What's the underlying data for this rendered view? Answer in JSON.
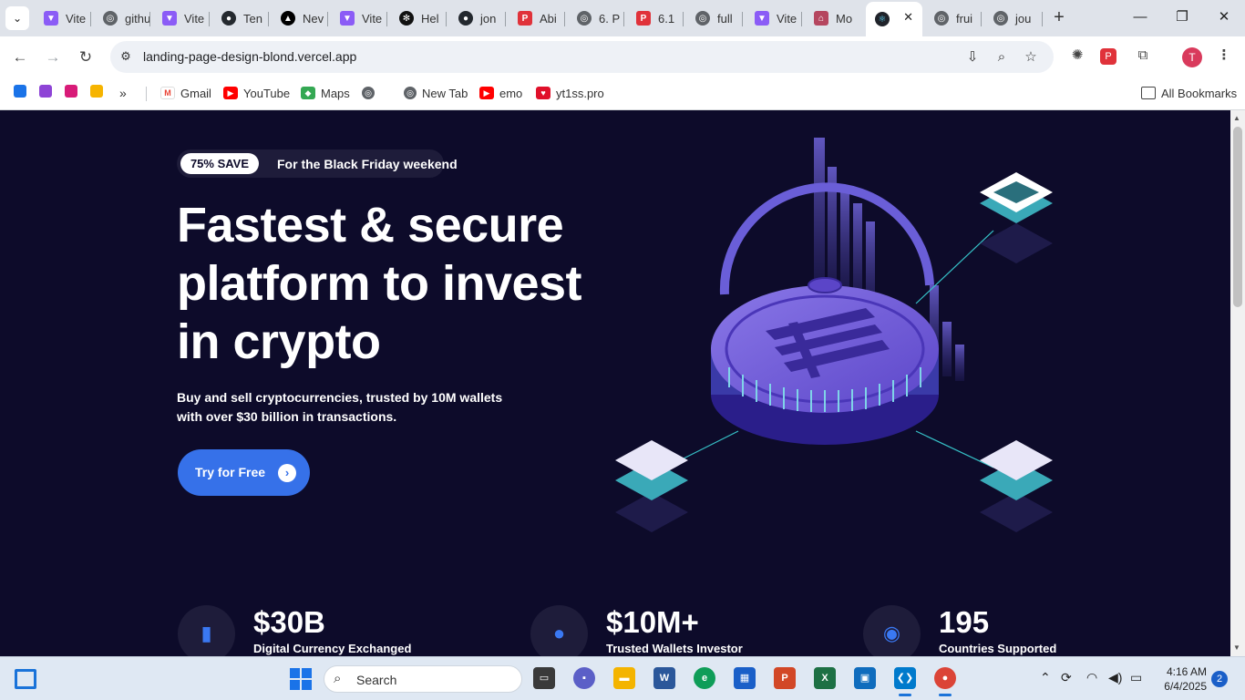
{
  "browser": {
    "tabs": [
      {
        "title": "Vite",
        "icon": "vite-icon"
      },
      {
        "title": "github",
        "icon": "globe-icon"
      },
      {
        "title": "Vite",
        "icon": "vite-icon"
      },
      {
        "title": "Ten",
        "icon": "github-icon"
      },
      {
        "title": "Nev",
        "icon": "vercel-icon"
      },
      {
        "title": "Vite",
        "icon": "vite-icon"
      },
      {
        "title": "Hel",
        "icon": "openai-icon"
      },
      {
        "title": "jon",
        "icon": "github-icon"
      },
      {
        "title": "Abi",
        "icon": "pdf-icon"
      },
      {
        "title": "6. P",
        "icon": "globe-icon"
      },
      {
        "title": "6.1",
        "icon": "pdf-icon"
      },
      {
        "title": "full",
        "icon": "globe-icon"
      },
      {
        "title": "Vite",
        "icon": "vite-icon"
      },
      {
        "title": "Mo",
        "icon": "house-icon"
      },
      {
        "title": "",
        "icon": "react-icon",
        "active": true
      },
      {
        "title": "frui",
        "icon": "globe-icon"
      },
      {
        "title": "jou",
        "icon": "globe-icon"
      }
    ],
    "url": "landing-page-design-blond.vercel.app",
    "profile_initial": "T",
    "bookmarks": [
      {
        "label": "Gmail",
        "icon": "gmail-icon"
      },
      {
        "label": "YouTube",
        "icon": "youtube-icon"
      },
      {
        "label": "Maps",
        "icon": "maps-icon"
      },
      {
        "label": "",
        "icon": "globe-icon"
      },
      {
        "label": "New Tab",
        "icon": "globe-icon"
      },
      {
        "label": "emo",
        "icon": "youtube-icon"
      },
      {
        "label": "yt1ss.pro",
        "icon": "yt1ss-icon"
      }
    ],
    "all_bookmarks_label": "All Bookmarks"
  },
  "page": {
    "promo_badge": "75% SAVE",
    "promo_text": "For the Black Friday weekend",
    "headline_line1": "Fastest & secure",
    "headline_line2": "platform to invest",
    "headline_line3": "in crypto",
    "subtext": "Buy and sell cryptocurrencies, trusted by 10M wallets with over $30 billion in transactions.",
    "cta_label": "Try for Free",
    "stats": [
      {
        "value": "$30B",
        "caption": "Digital Currency Exchanged",
        "icon": "bar-chart-icon"
      },
      {
        "value": "$10M+",
        "caption": "Trusted Wallets Investor",
        "icon": "user-icon"
      },
      {
        "value": "195",
        "caption": "Countries Supported",
        "icon": "globe-icon"
      }
    ],
    "colors": {
      "background": "#0d0b2a",
      "accent": "#3671e9",
      "badge_bg": "#1e1c3a"
    }
  },
  "taskbar": {
    "search_label": "Search",
    "time": "4:16 AM",
    "date": "6/4/2025",
    "notifications": "2"
  }
}
